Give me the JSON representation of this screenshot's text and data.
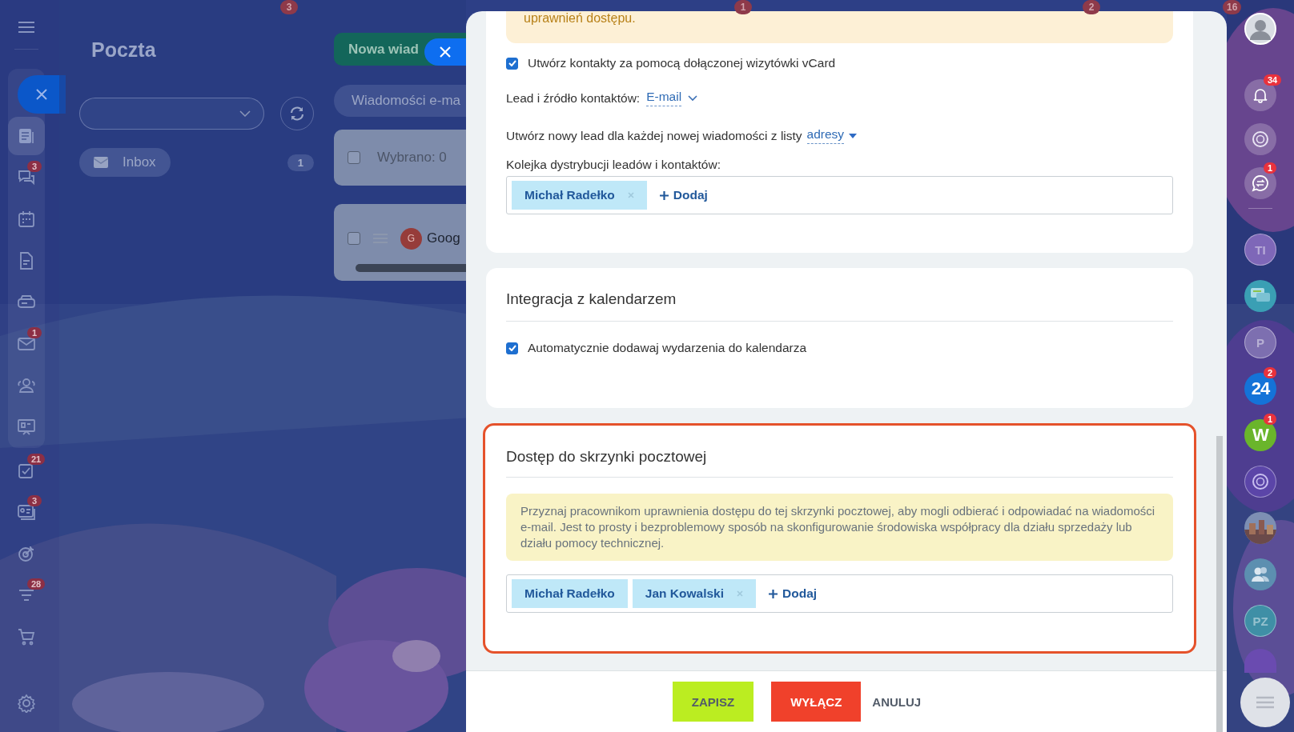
{
  "top_badges": [
    {
      "text": "3"
    },
    {
      "text": "1"
    },
    {
      "text": "2"
    },
    {
      "text": "16"
    }
  ],
  "left_sidebar": {
    "items": [
      {
        "kind": "feed",
        "selected": true
      },
      {
        "kind": "chat",
        "badge": "3",
        "selected": false
      },
      {
        "kind": "calendar",
        "selected": false
      },
      {
        "kind": "document",
        "selected": false
      },
      {
        "kind": "drive",
        "selected": false
      },
      {
        "kind": "mail",
        "badge": "1",
        "selected": false
      },
      {
        "kind": "contacts",
        "selected": false
      },
      {
        "kind": "board",
        "selected": false
      },
      {
        "kind": "tasks",
        "badge": "21",
        "selected": false
      },
      {
        "kind": "card",
        "badge": "3",
        "selected": false
      },
      {
        "kind": "target",
        "selected": false
      },
      {
        "kind": "funnel",
        "badge": "28",
        "selected": false
      },
      {
        "kind": "cart",
        "selected": false
      }
    ]
  },
  "mail": {
    "title": "Poczta",
    "folder": {
      "label": "Inbox",
      "count": "1"
    },
    "new_message_button": "Nowa wiad",
    "search": {
      "placeholder": "Wiadomości e-ma"
    },
    "selection": {
      "label": "Wybrano: 0",
      "checked": false
    },
    "messages": [
      {
        "avatar": "G",
        "sender": "Goog",
        "checked": false
      }
    ]
  },
  "settings": {
    "notice_tail": "uprawnień dostępu.",
    "vcard": {
      "label": "Utwórz kontakty za pomocą dołączonej wizytówki vCard",
      "checked": true
    },
    "lead_source": {
      "label": "Lead i źródło kontaktów:",
      "value": "E-mail"
    },
    "new_lead": {
      "label": "Utwórz nowy lead dla każdej nowej wiadomości z listy",
      "value": "adresy"
    },
    "queue": {
      "label": "Kolejka dystrybucji leadów i kontaktów:",
      "users": [
        {
          "name": "Michał Radełko",
          "removable": true
        }
      ],
      "add": "Dodaj"
    },
    "calendar": {
      "title": "Integracja z kalendarzem",
      "option": {
        "label": "Automatycznie dodawaj wydarzenia do kalendarza",
        "checked": true
      }
    },
    "access": {
      "title": "Dostęp do skrzynki pocztowej",
      "highlighted": true,
      "info": "Przyznaj pracownikom uprawnienia dostępu do tej skrzynki pocztowej, aby mogli odbierać i odpowiadać na wiadomości e-mail. Jest to prosty i bezproblemowy sposób na skonfigurowanie środowiska współpracy dla działu sprzedaży lub działu pomocy technicznej.",
      "users": [
        {
          "name": "Michał Radełko",
          "removable": false
        },
        {
          "name": "Jan Kowalski",
          "removable": true
        }
      ],
      "add": "Dodaj"
    },
    "buttons": [
      {
        "kind": "save",
        "label": "ZAPISZ"
      },
      {
        "kind": "disable",
        "label": "WYŁĄCZ"
      },
      {
        "kind": "cancel",
        "label": "ANULUJ"
      }
    ]
  },
  "right_bar": {
    "top": [
      {
        "kind": "user"
      },
      {
        "kind": "bell",
        "badge": "34"
      },
      {
        "kind": "copilot"
      },
      {
        "kind": "chat-swap",
        "badge": "1"
      }
    ],
    "apps": [
      {
        "kind": "initials",
        "text": "TI",
        "color": "#7e67b8"
      },
      {
        "kind": "chat",
        "color": "#3a9fb4"
      },
      {
        "kind": "initials",
        "text": "P",
        "color": "#7d6fb0"
      },
      {
        "kind": "logo",
        "text": "24",
        "badge": "2",
        "color": "#1473d8"
      },
      {
        "kind": "logo",
        "text": "W",
        "badge": "1",
        "color": "#6ab52b"
      },
      {
        "kind": "copilot",
        "color": "#5b45a8"
      },
      {
        "kind": "picture"
      },
      {
        "kind": "group",
        "color": "#5c8fb0"
      },
      {
        "kind": "initials",
        "text": "PZ",
        "color": "#3f8fa6"
      }
    ]
  }
}
